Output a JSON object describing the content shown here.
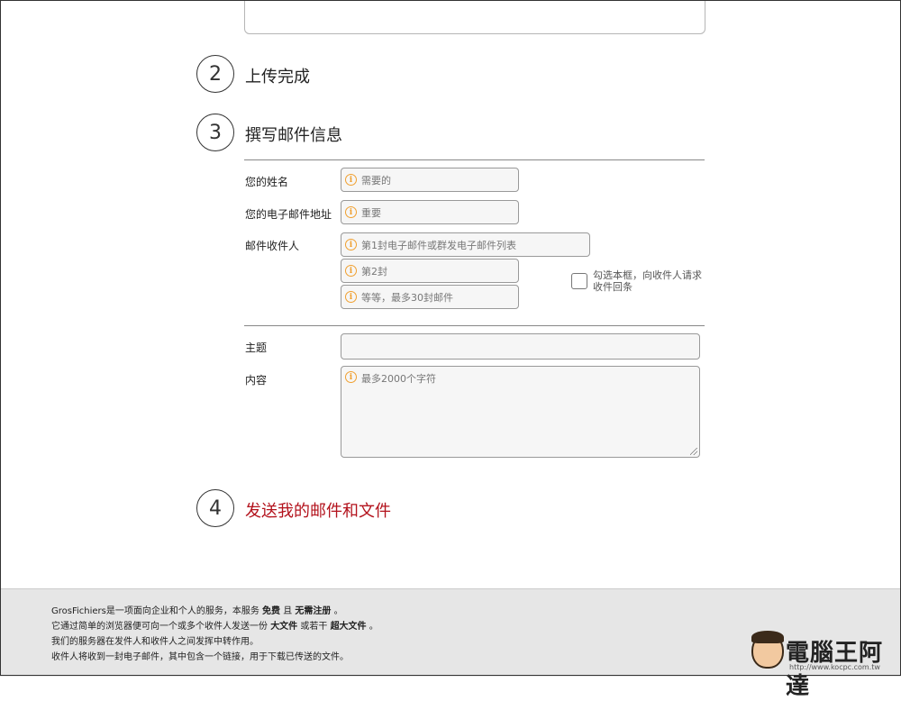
{
  "steps": [
    {
      "number": "2",
      "title": "上传完成"
    },
    {
      "number": "3",
      "title": "撰写邮件信息"
    },
    {
      "number": "4",
      "title": "发送我的邮件和文件"
    }
  ],
  "form": {
    "name_label": "您的姓名",
    "name_placeholder": "需要的",
    "email_label": "您的电子邮件地址",
    "email_placeholder": "重要",
    "recipients_label": "邮件收件人",
    "recipient1_placeholder": "第1封电子邮件或群发电子邮件列表",
    "recipient2_placeholder": "第2封",
    "recipient3_placeholder": "等等，最多30封邮件",
    "receipt_checkbox_label": "勾选本框，向收件人请求收件回条",
    "subject_label": "主题",
    "subject_value": "",
    "content_label": "内容",
    "content_placeholder": "最多2000个字符"
  },
  "footer": {
    "line1_a": "GrosFichiers是一项面向企业和个人的服务，本服务",
    "line1_b": "免费",
    "line1_c": "且",
    "line1_d": "无需注册",
    "line1_e": "。",
    "line2_a": "它通过简单的浏览器便可向一个或多个收件人发送一份",
    "line2_b": "大文件",
    "line2_c": "或若干",
    "line2_d": "超大文件",
    "line2_e": "。",
    "line3": "我们的服务器在发件人和收件人之间发挥中转作用。",
    "line4": "收件人将收到一封电子邮件，其中包含一个链接，用于下载已传送的文件。"
  },
  "watermark": {
    "text": "電腦王阿達",
    "url": "http://www.kocpc.com.tw"
  },
  "colors": {
    "accent_red": "#b3121c",
    "info_orange": "#f0a030",
    "footer_bg": "#e6e6e6"
  },
  "icons": {
    "field_hint": "info-circle-icon"
  }
}
